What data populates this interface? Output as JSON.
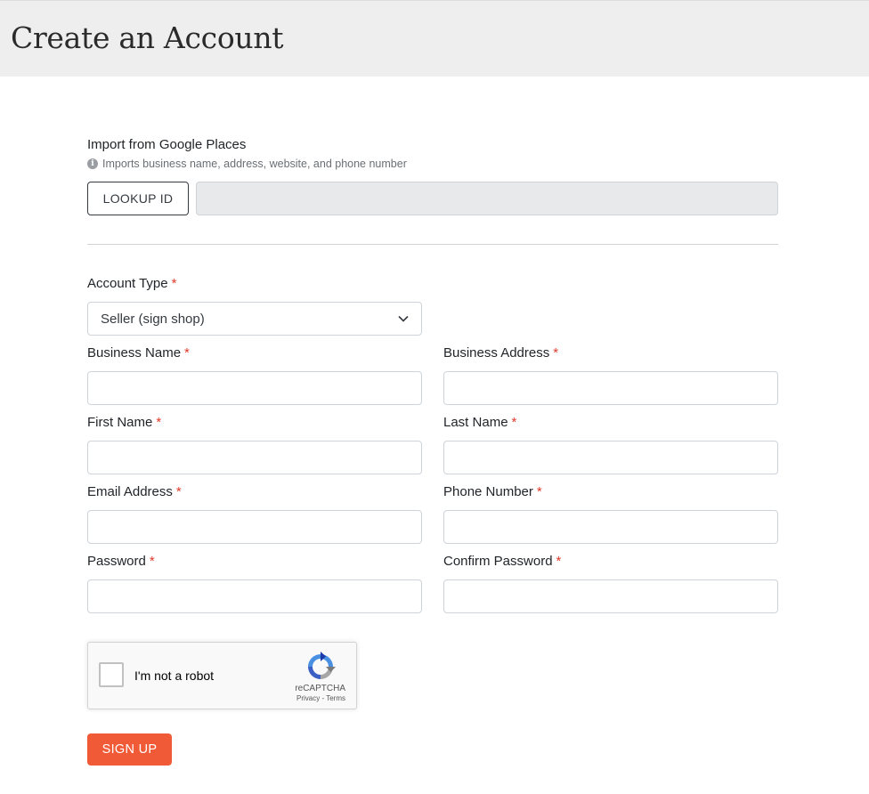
{
  "header": {
    "title": "Create an Account"
  },
  "import": {
    "label": "Import from Google Places",
    "hint": "Imports business name, address, website, and phone number",
    "info_icon": "i",
    "lookup_button": "LOOKUP ID",
    "lookup_value": ""
  },
  "account_type": {
    "label": "Account Type",
    "required": "*",
    "selected": "Seller (sign shop)"
  },
  "fields": {
    "business_name": {
      "label": "Business Name",
      "required": "*",
      "value": ""
    },
    "business_address": {
      "label": "Business Address",
      "required": "*",
      "value": ""
    },
    "first_name": {
      "label": "First Name",
      "required": "*",
      "value": ""
    },
    "last_name": {
      "label": "Last Name",
      "required": "*",
      "value": ""
    },
    "email": {
      "label": "Email Address",
      "required": "*",
      "value": ""
    },
    "phone": {
      "label": "Phone Number",
      "required": "*",
      "value": ""
    },
    "password": {
      "label": "Password",
      "required": "*",
      "value": ""
    },
    "confirm_password": {
      "label": "Confirm Password",
      "required": "*",
      "value": ""
    }
  },
  "captcha": {
    "text": "I'm not a robot",
    "brand": "reCAPTCHA",
    "privacy": "Privacy",
    "separator": " - ",
    "terms": "Terms"
  },
  "submit": {
    "label": "SIGN UP"
  },
  "colors": {
    "accent": "#f15a36",
    "required": "#e03a2a",
    "header_bg": "#eeeeee"
  }
}
